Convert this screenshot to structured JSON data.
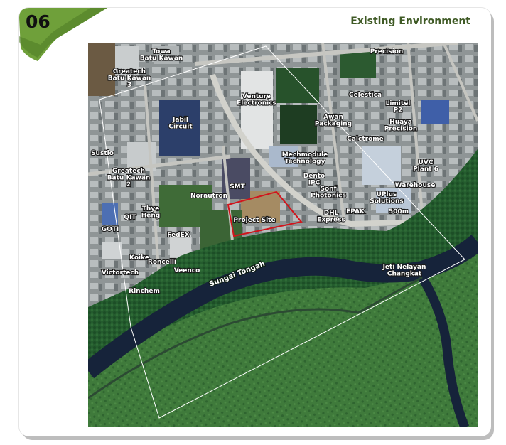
{
  "header": {
    "section_number": "06",
    "title": "Existing Environment"
  },
  "colors": {
    "accent_green": "#6fa03a",
    "title_green": "#3f5a25",
    "project_boundary": "#d1141c"
  },
  "map": {
    "labels": [
      {
        "key": "towa",
        "lines": [
          "Towa",
          "Batu Kawan"
        ]
      },
      {
        "key": "greatech3",
        "lines": [
          "Greatech",
          "Batu Kawan",
          "3"
        ]
      },
      {
        "key": "venture",
        "lines": [
          "Venture",
          "Electronics"
        ]
      },
      {
        "key": "precision",
        "lines": [
          "Precision"
        ]
      },
      {
        "key": "celestica",
        "lines": [
          "Celestica"
        ]
      },
      {
        "key": "limitel",
        "lines": [
          "Limitel",
          "P2"
        ]
      },
      {
        "key": "awan",
        "lines": [
          "Awan",
          "Packaging"
        ]
      },
      {
        "key": "huaya",
        "lines": [
          "Huaya",
          "Precision"
        ]
      },
      {
        "key": "jabil",
        "lines": [
          "Jabil",
          "Circuit"
        ]
      },
      {
        "key": "calctrome",
        "lines": [
          "Calctrome"
        ]
      },
      {
        "key": "sustio",
        "lines": [
          "Sustio"
        ]
      },
      {
        "key": "mechmodule",
        "lines": [
          "Mechmodule",
          "Technology"
        ]
      },
      {
        "key": "uvc",
        "lines": [
          "UVC",
          "Plant 6"
        ]
      },
      {
        "key": "greatech2",
        "lines": [
          "Greatech",
          "Batu Kawan",
          "2"
        ]
      },
      {
        "key": "dento",
        "lines": [
          "Dento",
          "IPC"
        ]
      },
      {
        "key": "warehouse",
        "lines": [
          "Warehouse"
        ]
      },
      {
        "key": "smt",
        "lines": [
          "SMT"
        ]
      },
      {
        "key": "norautron",
        "lines": [
          "Norautron"
        ]
      },
      {
        "key": "sonf",
        "lines": [
          "Sonf",
          "Photonics"
        ]
      },
      {
        "key": "uplus",
        "lines": [
          "UPlus",
          "Solutions"
        ]
      },
      {
        "key": "thye",
        "lines": [
          "Thye",
          "Heng"
        ]
      },
      {
        "key": "qit",
        "lines": [
          "QIT"
        ]
      },
      {
        "key": "dhl",
        "lines": [
          "DHL",
          "Express"
        ]
      },
      {
        "key": "epak",
        "lines": [
          "EPAK"
        ]
      },
      {
        "key": "distance",
        "lines": [
          "500m"
        ]
      },
      {
        "key": "project",
        "lines": [
          "Project Site"
        ]
      },
      {
        "key": "goti",
        "lines": [
          "GOTI"
        ]
      },
      {
        "key": "fedex",
        "lines": [
          "FedEX"
        ]
      },
      {
        "key": "koike",
        "lines": [
          "Koike"
        ]
      },
      {
        "key": "roncelli",
        "lines": [
          "Roncelli"
        ]
      },
      {
        "key": "victortech",
        "lines": [
          "Victortech"
        ]
      },
      {
        "key": "veenco",
        "lines": [
          "Veenco"
        ]
      },
      {
        "key": "jeti",
        "lines": [
          "Jeti Nelayan",
          "Changkat"
        ]
      },
      {
        "key": "rinchem",
        "lines": [
          "Rinchem"
        ]
      }
    ],
    "river_label": "Sungai Tongah"
  }
}
